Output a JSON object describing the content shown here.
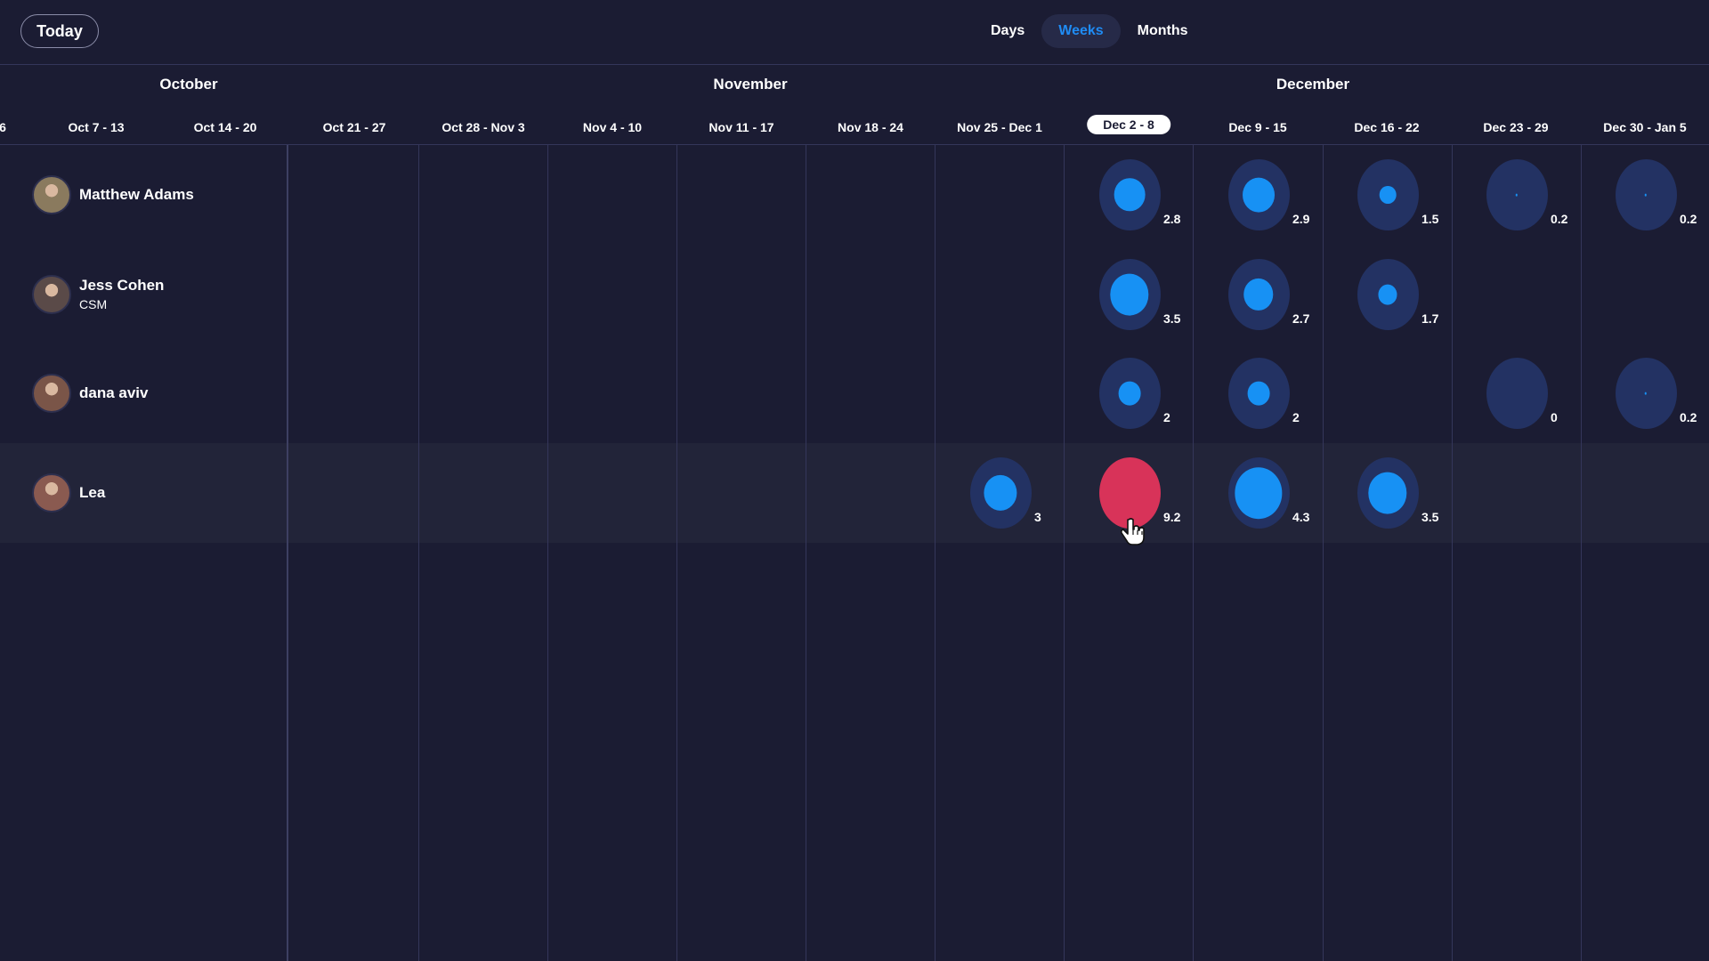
{
  "toolbar": {
    "today_label": "Today",
    "views": [
      {
        "label": "Days",
        "active": false
      },
      {
        "label": "Weeks",
        "active": true
      },
      {
        "label": "Months",
        "active": false
      }
    ]
  },
  "months": [
    "October",
    "November",
    "December"
  ],
  "weeks": [
    {
      "label": "6",
      "partial": true
    },
    {
      "label": "Oct 7 - 13"
    },
    {
      "label": "Oct 14 - 20"
    },
    {
      "label": "Oct 21 - 27"
    },
    {
      "label": "Oct 28 - Nov 3"
    },
    {
      "label": "Nov 4 - 10"
    },
    {
      "label": "Nov 11 - 17"
    },
    {
      "label": "Nov 18 - 24"
    },
    {
      "label": "Nov 25 - Dec 1"
    },
    {
      "label": "Dec 2 - 8",
      "current": true
    },
    {
      "label": "Dec 9 - 15"
    },
    {
      "label": "Dec 16 - 22"
    },
    {
      "label": "Dec 23 - 29"
    },
    {
      "label": "Dec 30 - Jan 5"
    }
  ],
  "people": [
    {
      "name": "Matthew Adams",
      "role": "",
      "avatar_color": "#8a7a5e",
      "allocations": [
        {
          "week": "Dec 2 - 8",
          "value": 2.8,
          "label": "2.8"
        },
        {
          "week": "Dec 9 - 15",
          "value": 2.9,
          "label": "2.9"
        },
        {
          "week": "Dec 16 - 22",
          "value": 1.5,
          "label": "1.5"
        },
        {
          "week": "Dec 23 - 29",
          "value": 0.2,
          "label": "0.2"
        },
        {
          "week": "Dec 30 - Jan 5",
          "value": 0.2,
          "label": "0.2"
        }
      ]
    },
    {
      "name": "Jess Cohen",
      "role": "CSM",
      "avatar_color": "#5a4a48",
      "allocations": [
        {
          "week": "Dec 2 - 8",
          "value": 3.5,
          "label": "3.5"
        },
        {
          "week": "Dec 9 - 15",
          "value": 2.7,
          "label": "2.7"
        },
        {
          "week": "Dec 16 - 22",
          "value": 1.7,
          "label": "1.7"
        }
      ]
    },
    {
      "name": "dana aviv",
      "role": "",
      "avatar_color": "#7a5548",
      "allocations": [
        {
          "week": "Dec 2 - 8",
          "value": 2,
          "label": "2"
        },
        {
          "week": "Dec 9 - 15",
          "value": 2,
          "label": "2"
        },
        {
          "week": "Dec 23 - 29",
          "value": 0,
          "label": "0"
        },
        {
          "week": "Dec 30 - Jan 5",
          "value": 0.2,
          "label": "0.2"
        }
      ]
    },
    {
      "name": "Lea",
      "role": "",
      "avatar_color": "#8a5a50",
      "highlighted": true,
      "allocations": [
        {
          "week": "Nov 25 - Dec 1",
          "value": 3,
          "label": "3"
        },
        {
          "week": "Dec 2 - 8",
          "value": 9.2,
          "label": "9.2",
          "over_capacity": true
        },
        {
          "week": "Dec 9 - 15",
          "value": 4.3,
          "label": "4.3"
        },
        {
          "week": "Dec 16 - 22",
          "value": 3.5,
          "label": "3.5"
        }
      ]
    }
  ],
  "colors": {
    "background": "#1b1c33",
    "bubble_ring": "#233263",
    "bubble_fill": "#1791f4",
    "over_capacity": "#d83359",
    "active_view": "#1f8cf5"
  }
}
